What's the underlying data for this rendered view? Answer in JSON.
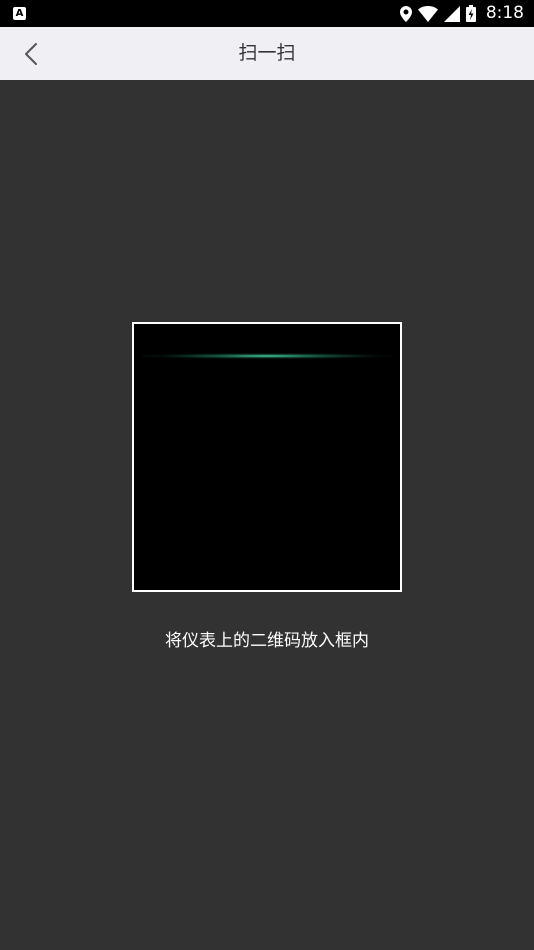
{
  "status_bar": {
    "left_icon": "A",
    "time": "8:18",
    "icons": [
      "location-icon",
      "wifi-icon",
      "signal-icon",
      "battery-charging-icon"
    ]
  },
  "nav": {
    "back_icon": "chevron-left-icon",
    "title": "扫一扫"
  },
  "scanner": {
    "hint": "将仪表上的二维码放入框内",
    "scan_line_color": "#3ddc9c",
    "frame_color": "#ffffff"
  }
}
